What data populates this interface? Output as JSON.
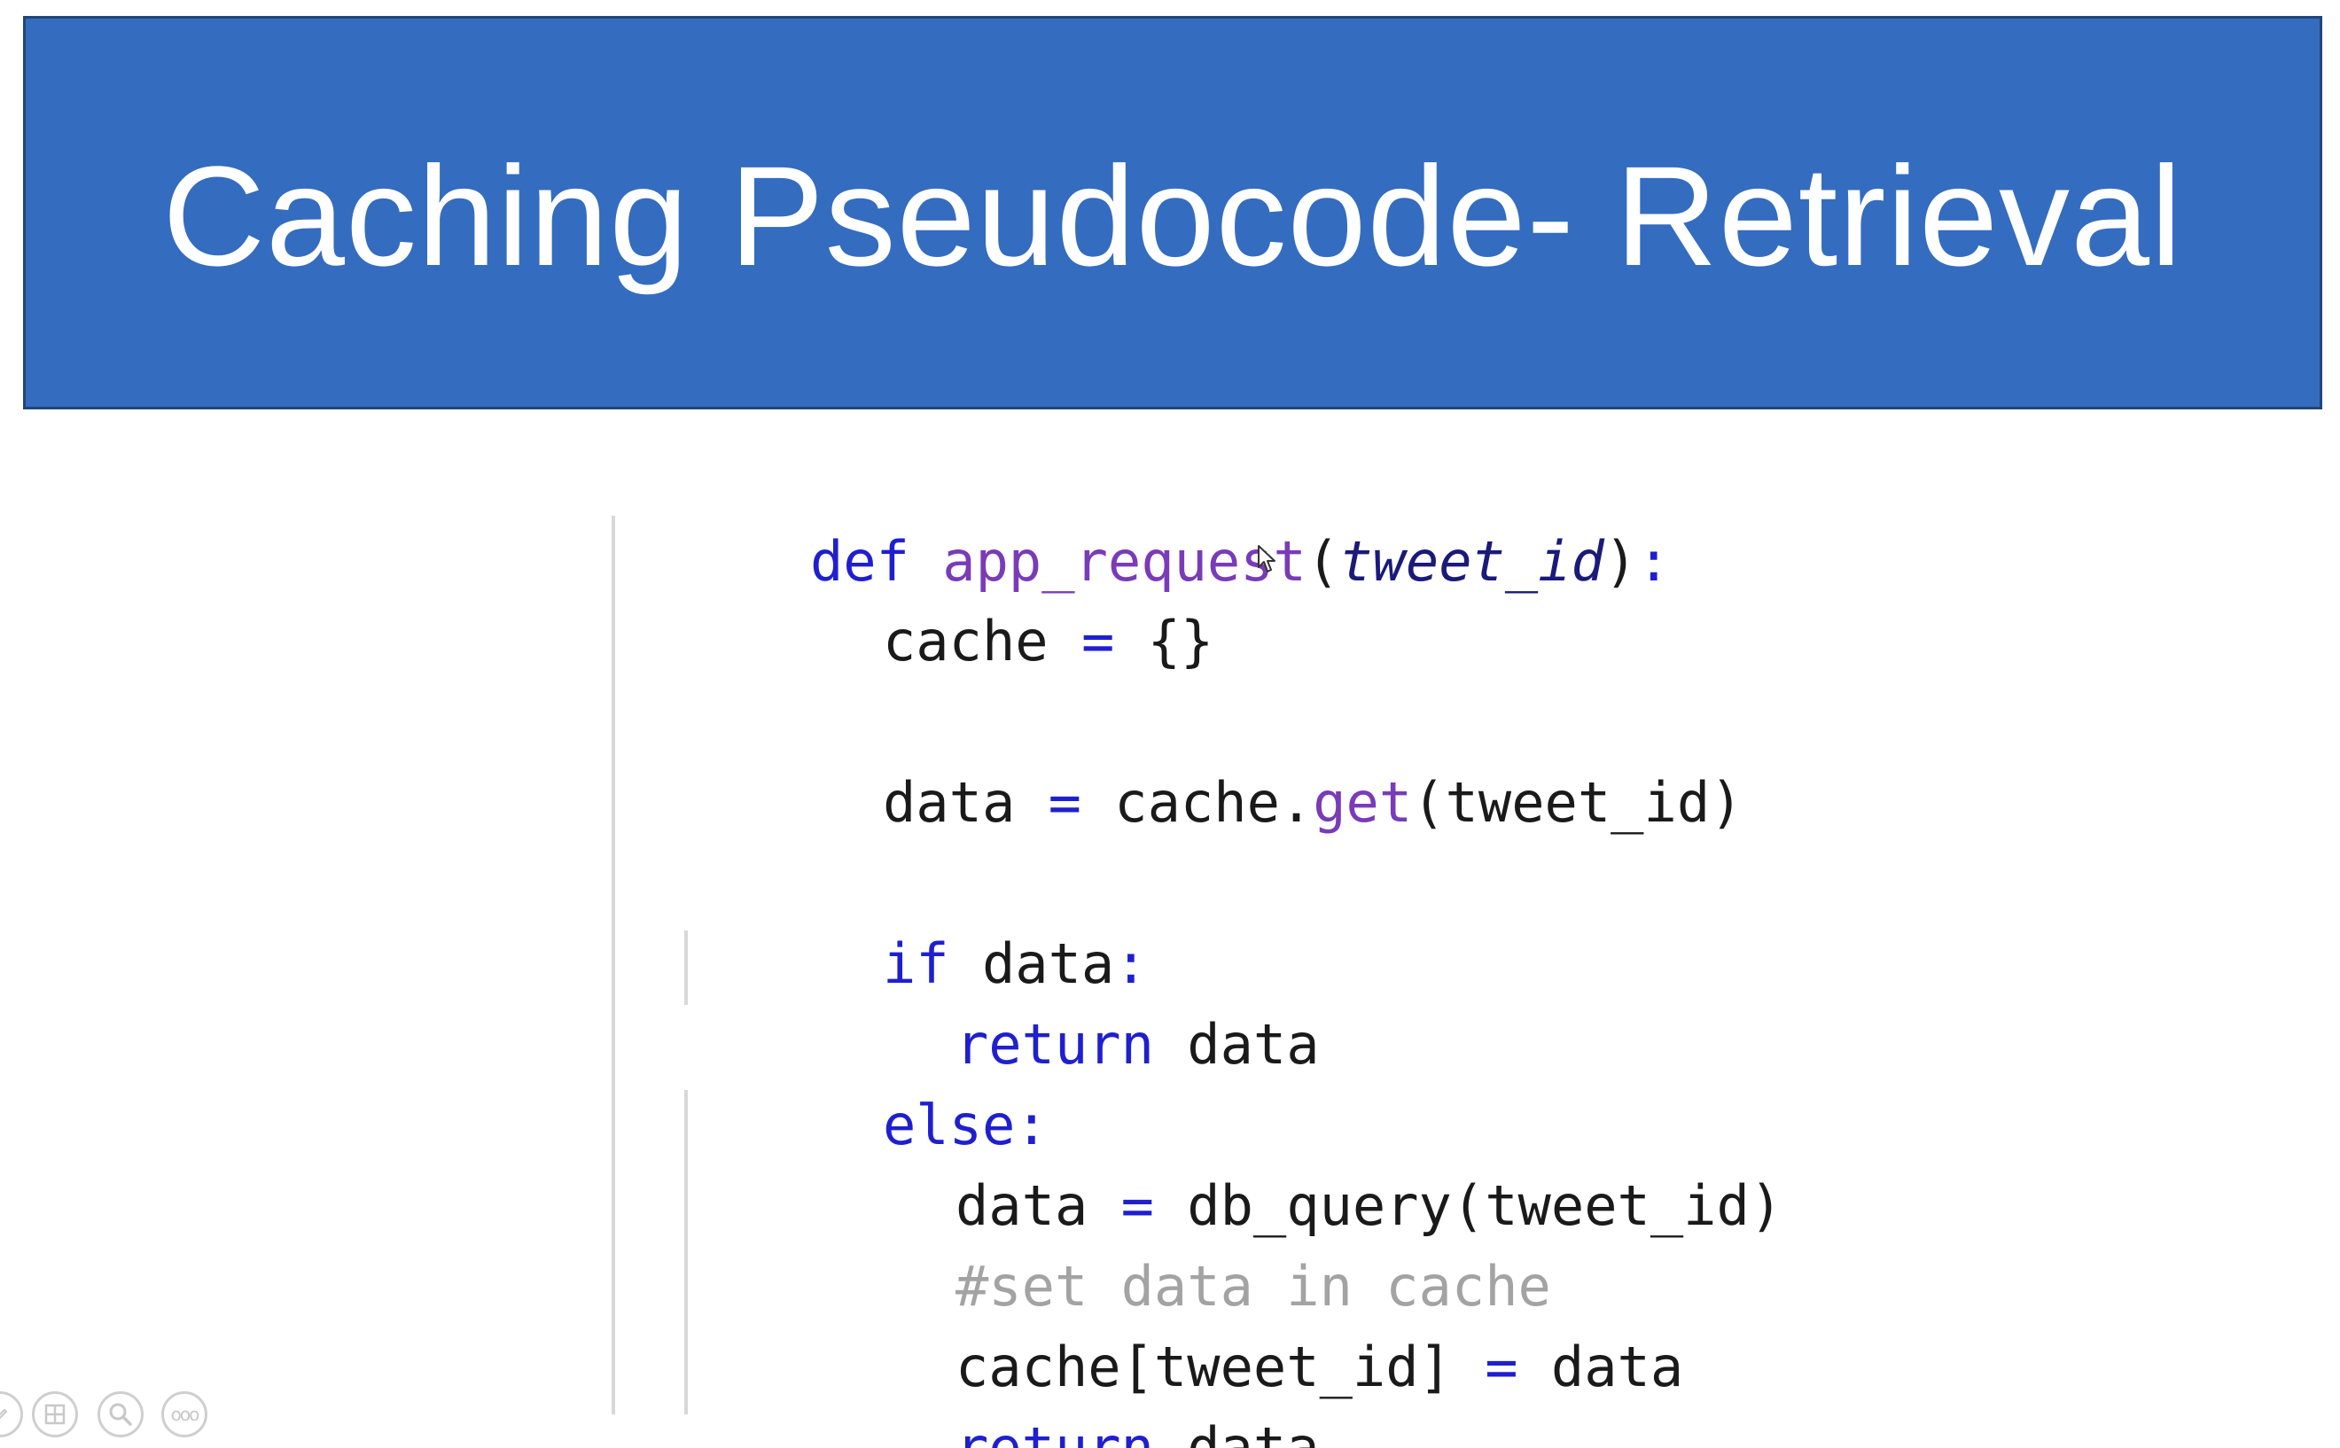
{
  "slide": {
    "title": "Caching Pseudocode- Retrieval",
    "colors": {
      "banner": "#346cc0",
      "keyword": "#1f1fd0",
      "function": "#7a3bb8",
      "comment": "#a3a3a3"
    }
  },
  "code": {
    "line1": {
      "kw": "def",
      "fn": "app_request",
      "open": "(",
      "param": "tweet_id",
      "close": ")",
      "colon": ":"
    },
    "line2": {
      "var": "cache",
      "op": "=",
      "rest": "{}"
    },
    "line3": {
      "var": "data",
      "op": "=",
      "obj": "cache.",
      "method": "get",
      "args": "(tweet_id)"
    },
    "line4": {
      "kw": "if",
      "rest": "data",
      "colon": ":"
    },
    "line5": {
      "kw": "return",
      "rest": "data"
    },
    "line6": {
      "kw": "else",
      "colon": ":"
    },
    "line7": {
      "var": "data",
      "op": "=",
      "rest": "db_query(tweet_id)"
    },
    "line8": {
      "comment": "#set data in cache"
    },
    "line9": {
      "var": "cache[tweet_id]",
      "op": "=",
      "rest": "data"
    },
    "line10": {
      "kw": "return",
      "rest": "data"
    }
  },
  "toolbar": {
    "icons": [
      "pen-icon",
      "slides-grid-icon",
      "zoom-icon",
      "more-options-icon"
    ],
    "more_label": "ooo"
  }
}
